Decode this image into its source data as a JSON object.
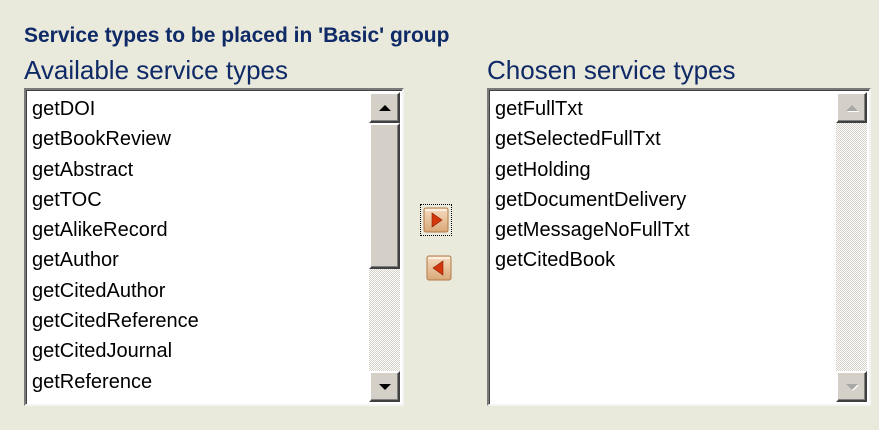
{
  "section": {
    "title": "Service types to be placed in 'Basic' group"
  },
  "available": {
    "label": "Available service types",
    "items": [
      "getDOI",
      "getBookReview",
      "getAbstract",
      "getTOC",
      "getAlikeRecord",
      "getAuthor",
      "getCitedAuthor",
      "getCitedReference",
      "getCitedJournal",
      "getReference"
    ]
  },
  "chosen": {
    "label": "Chosen service types",
    "items": [
      "getFullTxt",
      "getSelectedFullTxt",
      "getHolding",
      "getDocumentDelivery",
      "getMessageNoFullTxt",
      "getCitedBook"
    ]
  },
  "controls": {
    "add_icon": "arrow-right-icon",
    "remove_icon": "arrow-left-icon"
  },
  "colors": {
    "background": "#e9e9dc",
    "heading": "#0f2a66",
    "arrow": "#d2380c",
    "arrow_button": "#e8c8a0"
  }
}
